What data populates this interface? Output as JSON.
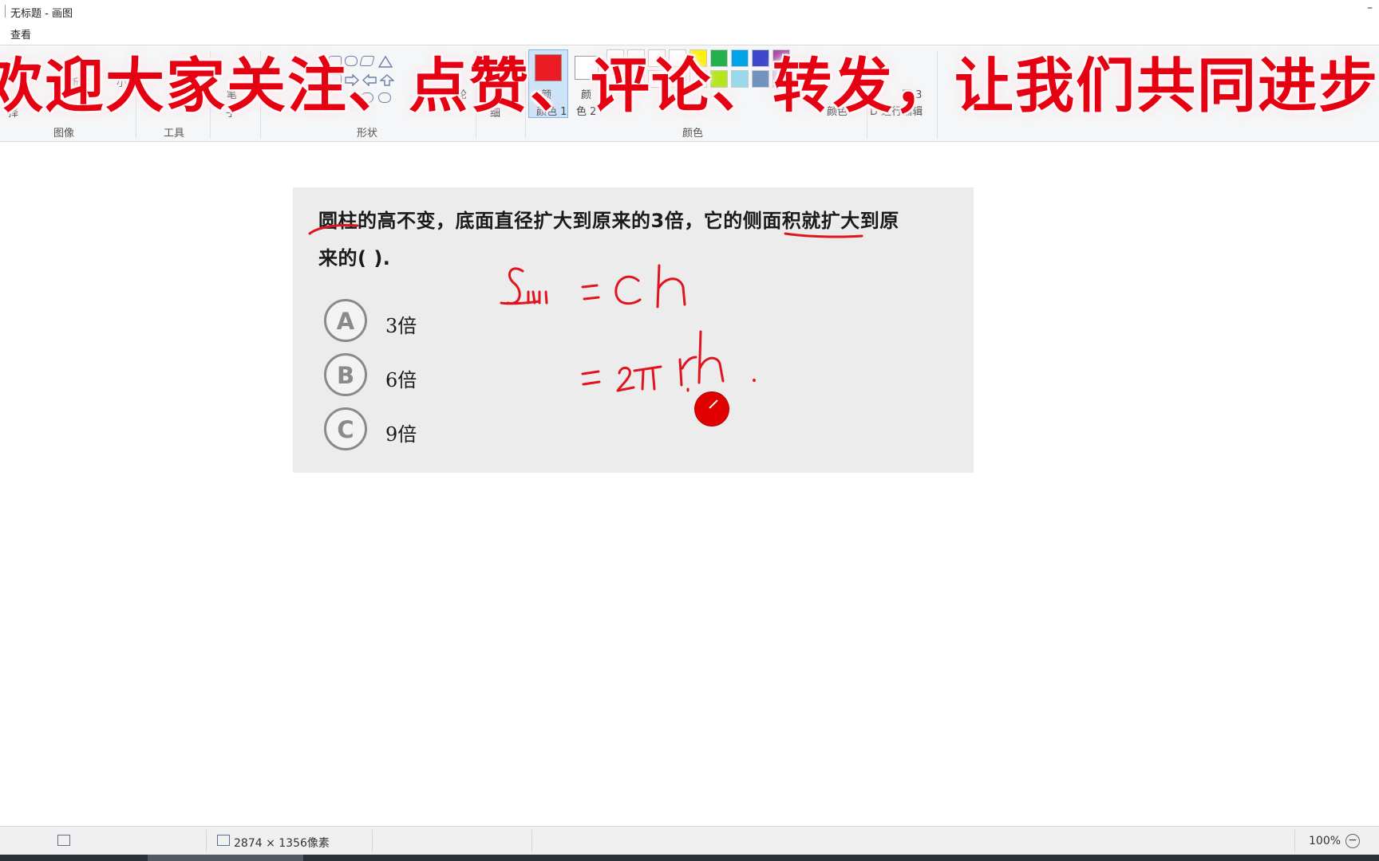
{
  "window": {
    "title": "无标题 - 画图",
    "minimize": "–"
  },
  "menu": {
    "view_tab": "查看"
  },
  "ribbon": {
    "fragments": {
      "new": "新建",
      "small": "小",
      "select": "择",
      "brush": "子",
      "brush_prefix": "笔",
      "outline": "轮",
      "thin": "细",
      "color1": "颜色 1",
      "color1_top": "颜",
      "color2": "色 2",
      "color2_top": "颜",
      "edit_colors": "颜色",
      "paint3d": "D 进行编辑",
      "paint3d_top": "图 3"
    },
    "groups": {
      "image": "图像",
      "tools": "工具",
      "shapes": "形状",
      "colors": "颜色"
    },
    "colors": {
      "color1": "#ed1c24",
      "color2": "#ffffff",
      "palette_top": [
        "#ffffff",
        "#ffffff",
        "#ffffff",
        "#ffffff",
        "#fff200",
        "#22b14c",
        "#00a2e8",
        "#3f48cc",
        "#a349a4"
      ],
      "palette_bottom": [
        "#ffffff",
        "#ffffff",
        "#ffffff",
        "#ffffff",
        "#ffffff",
        "#b5e61d",
        "#99d9ea",
        "#7092be",
        "#c8bfe7"
      ]
    }
  },
  "caption": "欢迎大家关注、点赞、评论、转发，让我们共同进步",
  "question": {
    "line1": "圆柱的高不变，底面直径扩大到原来的3倍，它的侧面积就扩大到原",
    "line2": "来的(        ).",
    "options": [
      {
        "letter": "A",
        "text": "3倍"
      },
      {
        "letter": "B",
        "text": "6倍"
      },
      {
        "letter": "C",
        "text": "9倍"
      }
    ]
  },
  "handwriting": {
    "line1": "S侧 = ch",
    "line2": "= 2πrh ."
  },
  "status": {
    "dimensions": "2874 × 1356像素",
    "zoom": "100%",
    "zoom_out": "−"
  }
}
